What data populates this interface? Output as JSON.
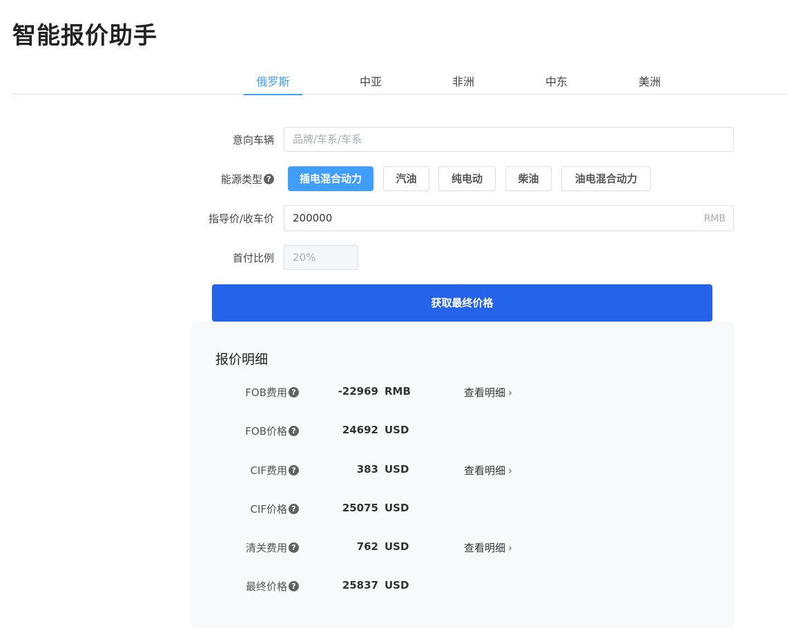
{
  "page_title": "智能报价助手",
  "tabs": [
    {
      "label": "俄罗斯",
      "active": true
    },
    {
      "label": "中亚",
      "active": false
    },
    {
      "label": "非洲",
      "active": false
    },
    {
      "label": "中东",
      "active": false
    },
    {
      "label": "美洲",
      "active": false
    }
  ],
  "form": {
    "vehicle": {
      "label": "意向车辆",
      "placeholder": "品牌/车系/车系",
      "value": ""
    },
    "energy": {
      "label": "能源类型",
      "options": [
        {
          "label": "插电混合动力",
          "selected": true
        },
        {
          "label": "汽油",
          "selected": false
        },
        {
          "label": "纯电动",
          "selected": false
        },
        {
          "label": "柴油",
          "selected": false
        },
        {
          "label": "油电混合动力",
          "selected": false
        }
      ]
    },
    "price": {
      "label": "指导价/收车价",
      "value": "200000",
      "unit": "RMB"
    },
    "down_payment": {
      "label": "首付比例",
      "value": "20%"
    }
  },
  "submit_label": "获取最终价格",
  "detail": {
    "title": "报价明细",
    "link_label": "查看明细",
    "rows": [
      {
        "label": "FOB费用",
        "value": "-22969",
        "unit": "RMB",
        "has_link": true
      },
      {
        "label": "FOB价格",
        "value": "24692",
        "unit": "USD",
        "has_link": false
      },
      {
        "label": "CIF费用",
        "value": "383",
        "unit": "USD",
        "has_link": true
      },
      {
        "label": "CIF价格",
        "value": "25075",
        "unit": "USD",
        "has_link": false
      },
      {
        "label": "清关费用",
        "value": "762",
        "unit": "USD",
        "has_link": true
      },
      {
        "label": "最终价格",
        "value": "25837",
        "unit": "USD",
        "has_link": false
      }
    ]
  },
  "icons": {
    "help": "question-circle-icon",
    "chevron": "chevron-right-icon"
  },
  "colors": {
    "accent": "#409eff",
    "primary_button": "#2563eb",
    "panel_bg": "#f8f9fb"
  }
}
